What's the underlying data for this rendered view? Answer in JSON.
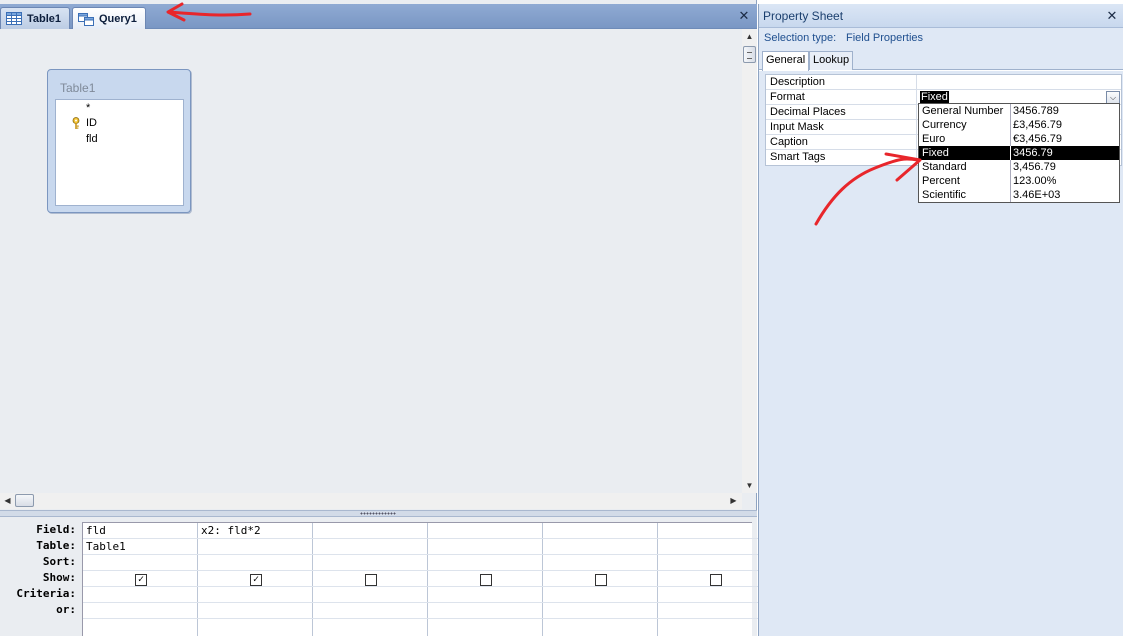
{
  "document_tabs": [
    {
      "label": "Table1",
      "icon": "table-icon",
      "active": false
    },
    {
      "label": "Query1",
      "icon": "query-icon",
      "active": true
    }
  ],
  "table_box": {
    "title": "Table1",
    "fields": [
      "*",
      "ID",
      "fld"
    ],
    "key_field_icon": "primary-key-icon"
  },
  "qbe": {
    "row_labels": [
      "Field:",
      "Table:",
      "Sort:",
      "Show:",
      "Criteria:",
      "or:"
    ],
    "columns": [
      {
        "field": "fld",
        "table": "Table1",
        "sort": "",
        "show": true,
        "criteria": "",
        "or": ""
      },
      {
        "field": "x2: fld*2",
        "table": "",
        "sort": "",
        "show": true,
        "criteria": "",
        "or": ""
      },
      {
        "field": "",
        "table": "",
        "sort": "",
        "show": false,
        "criteria": "",
        "or": ""
      },
      {
        "field": "",
        "table": "",
        "sort": "",
        "show": false,
        "criteria": "",
        "or": ""
      },
      {
        "field": "",
        "table": "",
        "sort": "",
        "show": false,
        "criteria": "",
        "or": ""
      },
      {
        "field": "",
        "table": "",
        "sort": "",
        "show": false,
        "criteria": "",
        "or": ""
      }
    ]
  },
  "property_sheet": {
    "title": "Property Sheet",
    "selection_type_label": "Selection type:",
    "selection_type_value": "Field Properties",
    "tabs": [
      {
        "label": "General",
        "active": true
      },
      {
        "label": "Lookup",
        "active": false
      }
    ],
    "properties": [
      {
        "name": "Description",
        "value": ""
      },
      {
        "name": "Format",
        "value": "Fixed"
      },
      {
        "name": "Decimal Places",
        "value": ""
      },
      {
        "name": "Input Mask",
        "value": ""
      },
      {
        "name": "Caption",
        "value": ""
      },
      {
        "name": "Smart Tags",
        "value": ""
      }
    ],
    "format_options": [
      {
        "name": "General Number",
        "sample": "3456.789"
      },
      {
        "name": "Currency",
        "sample": "£3,456.79"
      },
      {
        "name": "Euro",
        "sample": "€3,456.79"
      },
      {
        "name": "Fixed",
        "sample": "3456.79",
        "selected": true
      },
      {
        "name": "Standard",
        "sample": "3,456.79"
      },
      {
        "name": "Percent",
        "sample": "123.00%"
      },
      {
        "name": "Scientific",
        "sample": "3.46E+03"
      }
    ]
  },
  "colors": {
    "annotation": "#e8262b",
    "tabbar": "#7a97c4",
    "selected_option_bg": "#000000"
  }
}
